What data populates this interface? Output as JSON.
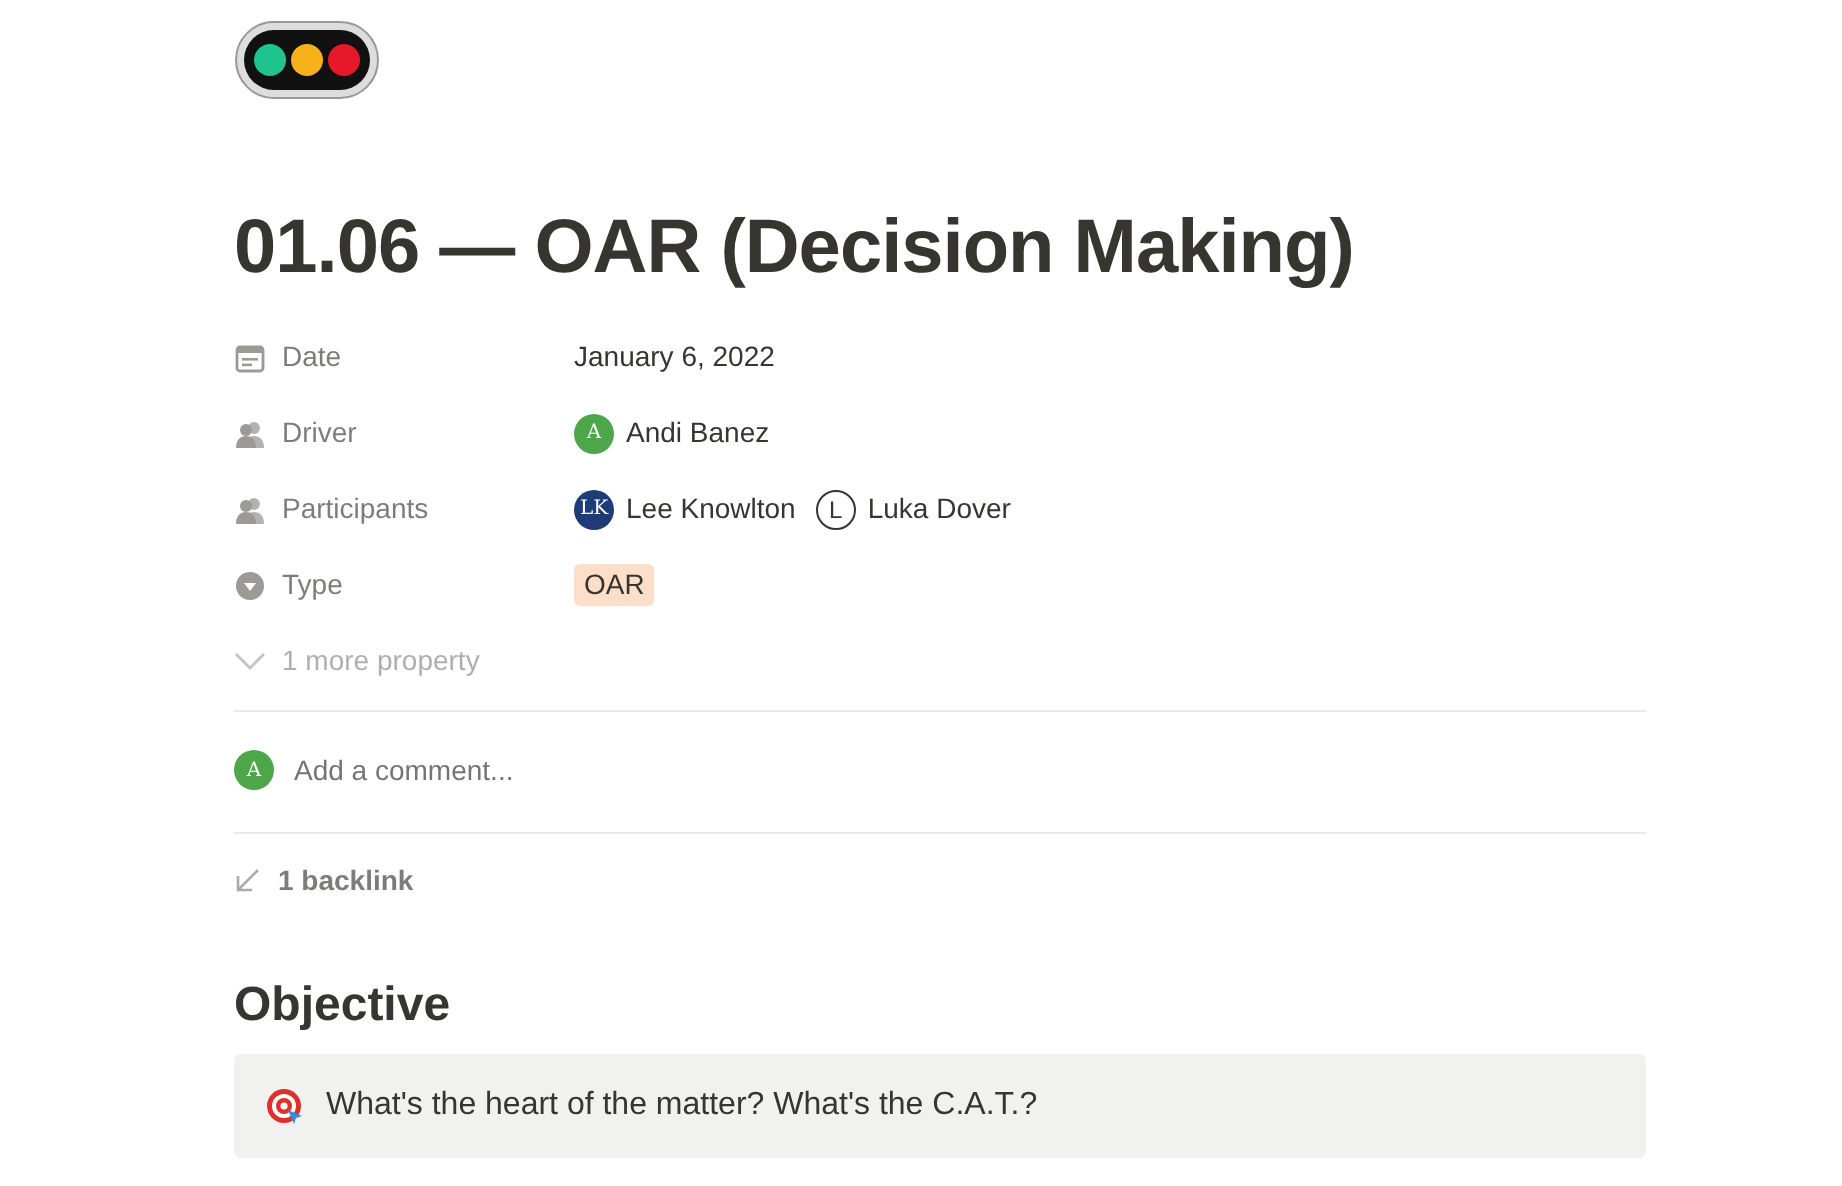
{
  "page": {
    "title": "01.06 — OAR (Decision Making)"
  },
  "properties": [
    {
      "kind": "date",
      "label": "Date",
      "value": "January 6, 2022"
    },
    {
      "kind": "person",
      "label": "Driver",
      "people": [
        {
          "initials": "A",
          "name": "Andi Banez",
          "color": "#4ea64a"
        }
      ]
    },
    {
      "kind": "person",
      "label": "Participants",
      "people": [
        {
          "initials": "LK",
          "name": "Lee Knowlton",
          "color": "#1d3c78"
        },
        {
          "initials": "L",
          "name": "Luka Dover",
          "color": "#ffffff"
        }
      ]
    },
    {
      "kind": "select",
      "label": "Type",
      "value": "OAR"
    }
  ],
  "more_properties": "1 more property",
  "comment": {
    "initials": "A",
    "placeholder": "Add a comment..."
  },
  "backlinks": "1 backlink",
  "sections": [
    {
      "heading": "Objective",
      "callout": "What's the heart of the matter? What's the C.A.T.?"
    }
  ]
}
